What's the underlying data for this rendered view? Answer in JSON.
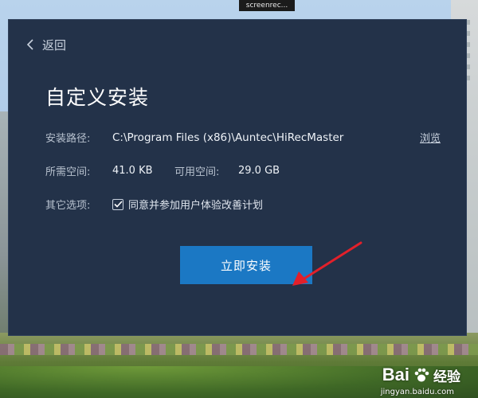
{
  "recorder": {
    "label": "screenrec..."
  },
  "dialog": {
    "back_label": "返回",
    "title": "自定义安装",
    "install_path": {
      "label": "安装路径:",
      "value": "C:\\Program Files (x86)\\Auntec\\HiRecMaster",
      "browse_label": "浏览"
    },
    "space": {
      "required_label": "所需空间:",
      "required_value": "41.0 KB",
      "available_label": "可用空间:",
      "available_value": "29.0 GB"
    },
    "options": {
      "label": "其它选项:",
      "checkbox_label": "同意并参加用户体验改善计划",
      "checked": true
    },
    "install_button_label": "立即安装"
  },
  "watermark": {
    "logo": "Bai",
    "suffix": "经验",
    "url": "jingyan.baidu.com"
  },
  "colors": {
    "dialog_bg": "#233249",
    "button_bg": "#1b78c4",
    "arrow": "#e2202a"
  }
}
